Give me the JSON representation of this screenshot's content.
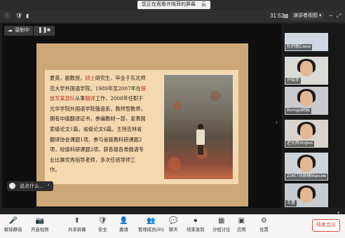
{
  "top": {
    "banner": "您正在观看许晓菲的屏幕",
    "share_symbol": "云",
    "timer": "31:52",
    "speaker_view": "演讲者视图"
  },
  "recording": {
    "status": "录制中"
  },
  "slide": {
    "lines": [
      {
        "parts": [
          {
            "t": "夏英，副教授，"
          },
          {
            "t": "硕士",
            "red": true
          },
          {
            "t": "研究生，毕业于东北师"
          }
        ]
      },
      {
        "parts": [
          {
            "t": "范大学外国语学院，1989年至2007年在"
          },
          {
            "t": "解",
            "red": true
          }
        ]
      },
      {
        "parts": [
          {
            "t": "放军某部队",
            "red": true
          },
          {
            "t": "从事"
          },
          {
            "t": "翻译",
            "red": true
          },
          {
            "t": "工作，2008年任职于"
          }
        ]
      },
      {
        "parts": [
          {
            "t": "光华学院外国语学院俄语系，教师型教师，"
          }
        ]
      },
      {
        "parts": [
          {
            "t": "拥有中级翻译证书，参编教材一部，发表国"
          }
        ]
      },
      {
        "parts": [
          {
            "t": "家级论文1篇，省级论文6篇，主持吉林省"
          }
        ]
      },
      {
        "parts": [
          {
            "t": "翻译协会课题1项，参与省级教科研课题2"
          }
        ]
      },
      {
        "parts": [
          {
            "t": "项，校级科研课题2项，获各级各类俄语专"
          }
        ]
      },
      {
        "parts": [
          {
            "t": "业比赛优秀指导老师，多次任班导师工"
          }
        ]
      },
      {
        "parts": [
          {
            "t": "作。"
          }
        ]
      }
    ]
  },
  "chat": {
    "placeholder": "说点什么...",
    "send": "☺"
  },
  "participants": [
    {
      "name": "杜轩鹏Саша",
      "bg": "#cfd8e2"
    },
    {
      "name": "许晓菲",
      "bg": "#d9dcd6"
    },
    {
      "name": "Володя姚娟",
      "bg": "#c9cbd0"
    },
    {
      "name": "迟光辉Anфия",
      "bg": "#d8d3cc"
    },
    {
      "name": "22407刘婉楠Максим",
      "bg": "#cdd3d9"
    },
    {
      "name": "王蕾",
      "bg": "#c6ccd1"
    }
  ],
  "toolbar": {
    "items": [
      {
        "glyph": "🎤",
        "label": "解除静音"
      },
      {
        "glyph": "📷",
        "label": "开启视频"
      },
      {
        "glyph": "⬆",
        "label": "共享屏幕"
      },
      {
        "glyph": "🛡",
        "label": "安全"
      },
      {
        "glyph": "👤",
        "label": "邀请"
      },
      {
        "glyph": "👥",
        "label": "管理成员(50)"
      },
      {
        "glyph": "💬",
        "label": "聊天"
      },
      {
        "glyph": "⏺",
        "label": "结束录制"
      },
      {
        "glyph": "▦",
        "label": "分组讨论"
      },
      {
        "glyph": "▣",
        "label": "应用"
      },
      {
        "glyph": "⚙",
        "label": "设置"
      }
    ],
    "end_meeting": "结束会议"
  }
}
